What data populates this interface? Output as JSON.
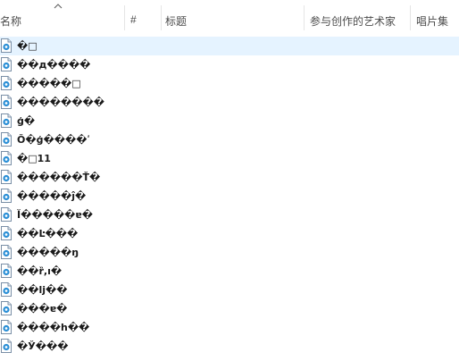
{
  "columns": {
    "name": "名称",
    "number": "#",
    "title": "标题",
    "artists": "参与创作的艺术家",
    "album": "唱片集"
  },
  "files": [
    {
      "name": "�□",
      "selected": true
    },
    {
      "name": "��д����"
    },
    {
      "name": "�����□"
    },
    {
      "name": "��������"
    },
    {
      "name": "ģ�"
    },
    {
      "name": "Ŏ�ģ����ʹ"
    },
    {
      "name": "�□11"
    },
    {
      "name": "������Ť�"
    },
    {
      "name": "�����ĵ�"
    },
    {
      "name": "Ĭ�����ɐ�"
    },
    {
      "name": "��Ŀ���"
    },
    {
      "name": "�����ŋ"
    },
    {
      "name": "��ȑ,ı�"
    },
    {
      "name": "��ǉ��"
    },
    {
      "name": "���ɐ�"
    },
    {
      "name": "����h��"
    },
    {
      "name": "�Ў���"
    }
  ]
}
